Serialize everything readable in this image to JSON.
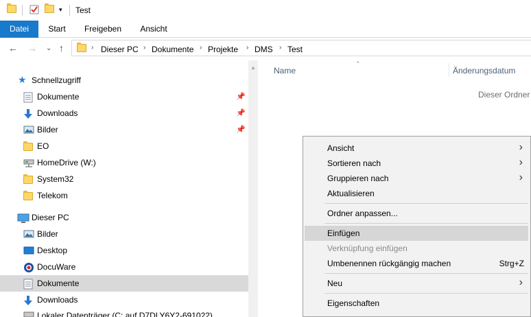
{
  "window": {
    "title": "Test"
  },
  "ribbon": {
    "tabs": [
      "Datei",
      "Start",
      "Freigeben",
      "Ansicht"
    ]
  },
  "address": {
    "crumbs": [
      "Dieser PC",
      "Dokumente",
      "Projekte",
      "DMS",
      "Test"
    ]
  },
  "nav": {
    "quick_access": "Schnellzugriff",
    "quick_items": [
      {
        "label": "Dokumente",
        "icon": "documents-icon"
      },
      {
        "label": "Downloads",
        "icon": "downloads-icon"
      },
      {
        "label": "Bilder",
        "icon": "pictures-icon"
      },
      {
        "label": "EO",
        "icon": "folder-icon"
      },
      {
        "label": "HomeDrive (W:)",
        "icon": "network-drive-icon"
      },
      {
        "label": "System32",
        "icon": "folder-icon"
      },
      {
        "label": "Telekom",
        "icon": "folder-icon"
      }
    ],
    "this_pc": "Dieser PC",
    "pc_items": [
      {
        "label": "Bilder",
        "icon": "pictures-icon"
      },
      {
        "label": "Desktop",
        "icon": "desktop-icon"
      },
      {
        "label": "DocuWare",
        "icon": "docuware-icon"
      },
      {
        "label": "Dokumente",
        "icon": "documents-icon"
      },
      {
        "label": "Downloads",
        "icon": "downloads-icon"
      },
      {
        "label": "Lokaler Datenträger (C: auf D7DLY6Y2-691022)",
        "icon": "drive-icon"
      }
    ]
  },
  "content": {
    "col_name": "Name",
    "col_date": "Änderungsdatum",
    "empty_message": "Dieser Ordner i"
  },
  "menu": {
    "ansicht": "Ansicht",
    "sortieren": "Sortieren nach",
    "gruppieren": "Gruppieren nach",
    "aktualisieren": "Aktualisieren",
    "anpassen": "Ordner anpassen...",
    "einfuegen": "Einfügen",
    "verknuepfung": "Verknüpfung einfügen",
    "umbenennen": "Umbenennen rückgängig machen",
    "umbenennen_shortcut": "Strg+Z",
    "neu": "Neu",
    "eigenschaften": "Eigenschaften"
  },
  "colors": {
    "accent": "#1979ca",
    "selected": "#d9d9d9",
    "menu_bg": "#f2f2f2"
  }
}
